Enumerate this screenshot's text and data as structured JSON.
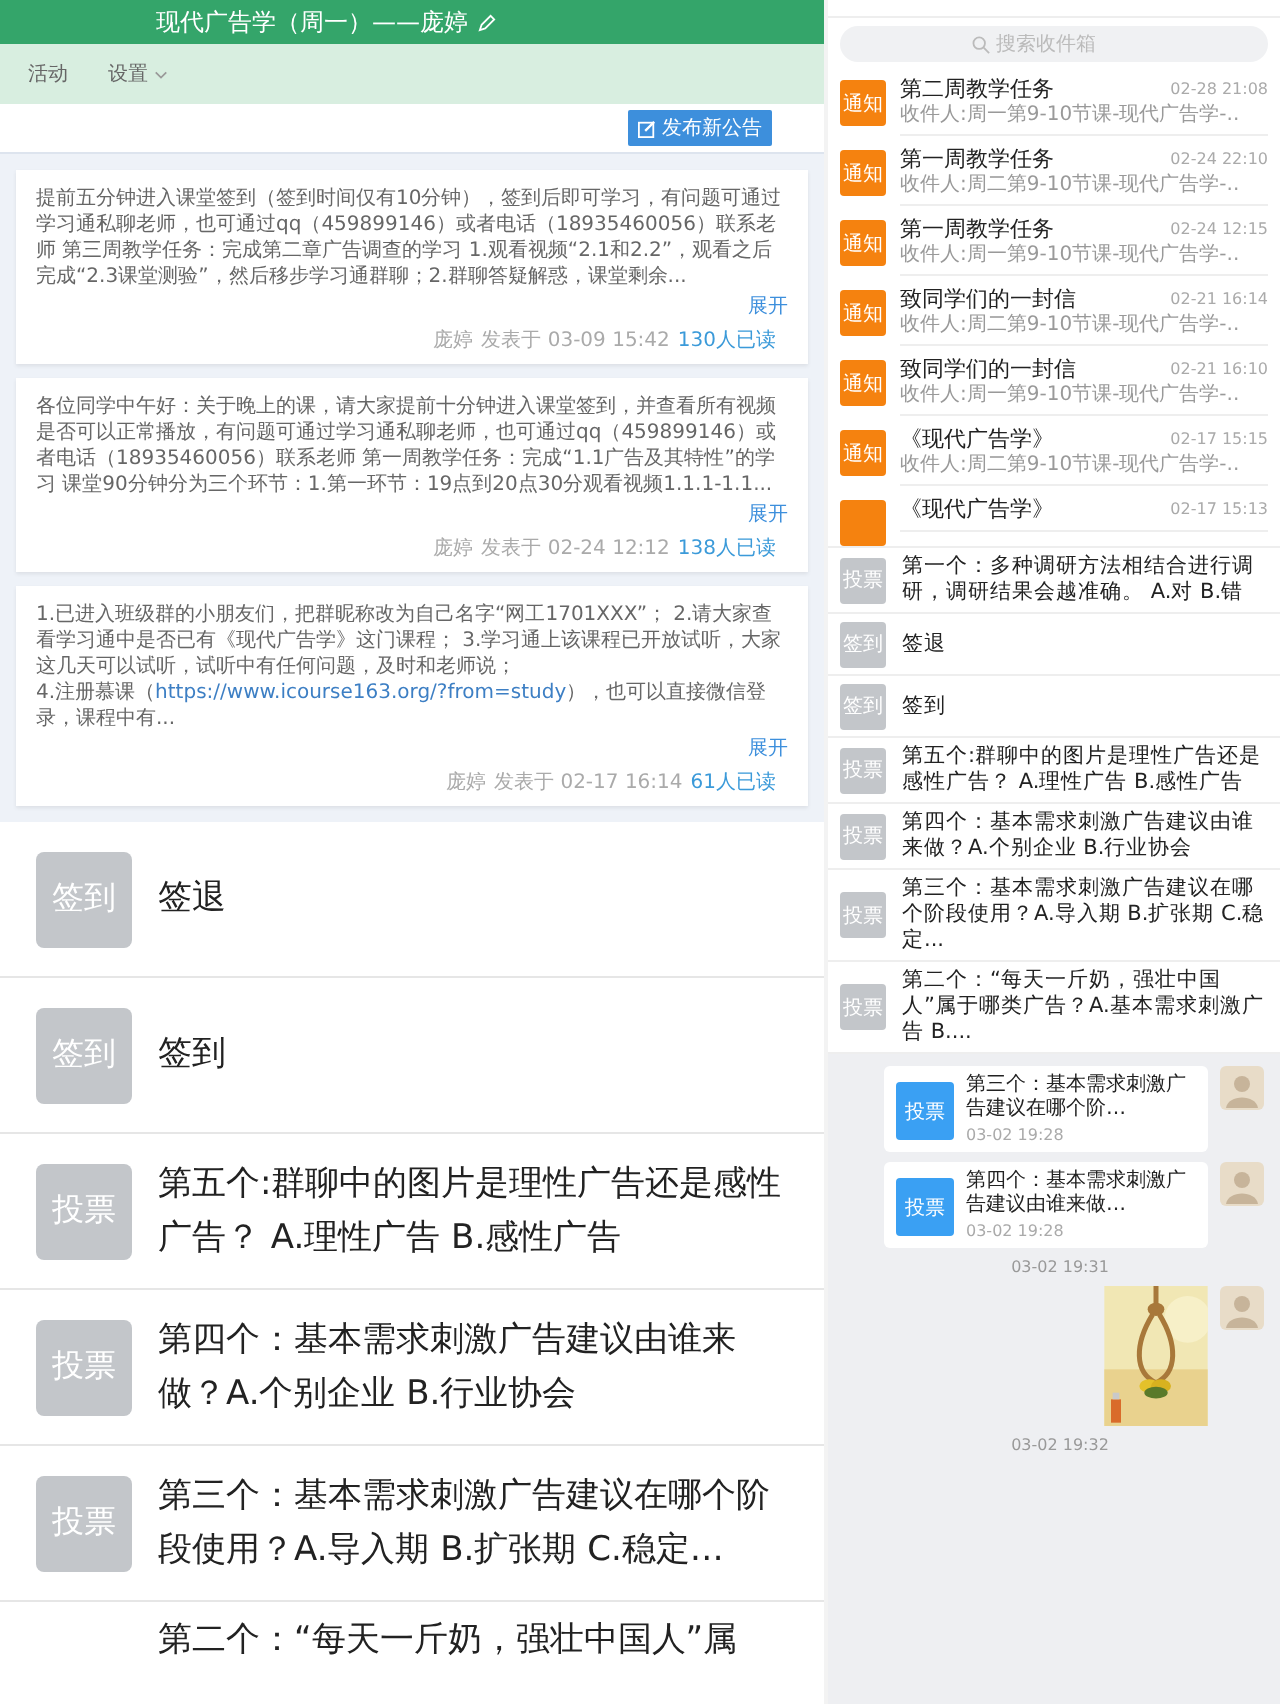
{
  "course": {
    "title": "现代广告学（周一）——庞婷",
    "tabs": [
      {
        "label": "活动",
        "dropdown": false
      },
      {
        "label": "设置",
        "dropdown": true
      }
    ],
    "publish_button": "发布新公告",
    "notices": [
      {
        "text": "提前五分钟进入课堂签到（签到时间仅有10分钟），签到后即可学习，有问题可通过学习通私聊老师，也可通过qq（459899146）或者电话（18935460056）联系老师 第三周教学任务：完成第二章广告调查的学习 1.观看视频“2.1和2.2”，观看之后完成“2.3课堂测验”，然后移步学习通群聊；2.群聊答疑解惑，课堂剩余...",
        "expand": "展开",
        "author": "庞婷",
        "posted": "发表于 03-09 15:42",
        "reads": "130人已读"
      },
      {
        "text": "各位同学中午好：关于晚上的课，请大家提前十分钟进入课堂签到，并查看所有视频是否可以正常播放，有问题可通过学习通私聊老师，也可通过qq（459899146）或者电话（18935460056）联系老师 第一周教学任务：完成“1.1广告及其特性”的学习 课堂90分钟分为三个环节：1.第一环节：19点到20点30分观看视频1.1.1-1.1...",
        "expand": "展开",
        "author": "庞婷",
        "posted": "发表于 02-24 12:12",
        "reads": "138人已读"
      },
      {
        "text": "1.已进入班级群的小朋友们，把群昵称改为自己名字“网工1701XXX”； 2.请大家查看学习通中是否已有《现代广告学》这门课程； 3.学习通上该课程已开放试听，大家这几天可以试听，试听中有任何问题，及时和老师说；\n4.注册慕课（",
        "link": "https://www.icourse163.org/?from=study",
        "text_after": "），也可以直接微信登录，课程中有...",
        "expand": "展开",
        "author": "庞婷",
        "posted": "发表于 02-17 16:14",
        "reads": "61人已读"
      }
    ]
  },
  "activities_large": [
    {
      "badge": "签到",
      "text": "签退"
    },
    {
      "badge": "签到",
      "text": "签到"
    },
    {
      "badge": "投票",
      "text": "第五个:群聊中的图片是理性广告还是感性广告？ A.理性广告 B.感性广告"
    },
    {
      "badge": "投票",
      "text": "第四个：基本需求刺激广告建议由谁来做？A.个别企业 B.行业协会"
    },
    {
      "badge": "投票",
      "text": "第三个：基本需求刺激广告建议在哪个阶段使用？A.导入期 B.扩张期 C.稳定…"
    },
    {
      "text": "第二个：“每天一斤奶，强壮中国人”属"
    }
  ],
  "inbox": {
    "search": {
      "placeholder": "搜索收件箱"
    },
    "items": [
      {
        "badge": "通知",
        "title": "第二周教学任务",
        "recipients": "收件人:周一第9-10节课-现代广告学-..",
        "time": "02-28 21:08"
      },
      {
        "badge": "通知",
        "title": "第一周教学任务",
        "recipients": "收件人:周二第9-10节课-现代广告学-..",
        "time": "02-24 22:10"
      },
      {
        "badge": "通知",
        "title": "第一周教学任务",
        "recipients": "收件人:周一第9-10节课-现代广告学-..",
        "time": "02-24 12:15"
      },
      {
        "badge": "通知",
        "title": "致同学们的一封信",
        "recipients": "收件人:周二第9-10节课-现代广告学-..",
        "time": "02-21 16:14"
      },
      {
        "badge": "通知",
        "title": "致同学们的一封信",
        "recipients": "收件人:周一第9-10节课-现代广告学-..",
        "time": "02-21 16:10"
      },
      {
        "badge": "通知",
        "title": "《现代广告学》",
        "recipients": "收件人:周二第9-10节课-现代广告学-..",
        "time": "02-17 15:15"
      },
      {
        "title": "《现代广告学》",
        "time": "02-17 15:13"
      }
    ]
  },
  "activities_small": [
    {
      "badge": "投票",
      "text": "第一个：多种调研方法相结合进行调研，调研结果会越准确。 A.对 B.错"
    },
    {
      "badge": "签到",
      "text": "签退"
    },
    {
      "badge": "签到",
      "text": "签到"
    },
    {
      "badge": "投票",
      "text": "第五个:群聊中的图片是理性广告还是感性广告？ A.理性广告 B.感性广告"
    },
    {
      "badge": "投票",
      "text": "第四个：基本需求刺激广告建议由谁来做？A.个别企业 B.行业协会"
    },
    {
      "badge": "投票",
      "text": "第三个：基本需求刺激广告建议在哪个阶段使用？A.导入期 B.扩张期 C.稳定..."
    },
    {
      "badge": "投票",
      "text": "第二个：“每天一斤奶，强壮中国人”属于哪类广告？A.基本需求刺激广告 B...."
    }
  ],
  "chat": [
    {
      "kind": "vote",
      "badge": "投票",
      "text": "第三个：基本需求刺激广告建议在哪个阶…",
      "time": "03-02 19:28"
    },
    {
      "kind": "vote",
      "badge": "投票",
      "text": "第四个：基本需求刺激广告建议由谁来做…",
      "time": "03-02 19:28"
    },
    {
      "kind": "timestamp",
      "text": "03-02 19:31"
    },
    {
      "kind": "picture"
    },
    {
      "kind": "timestamp",
      "text": "03-02 19:32"
    }
  ]
}
